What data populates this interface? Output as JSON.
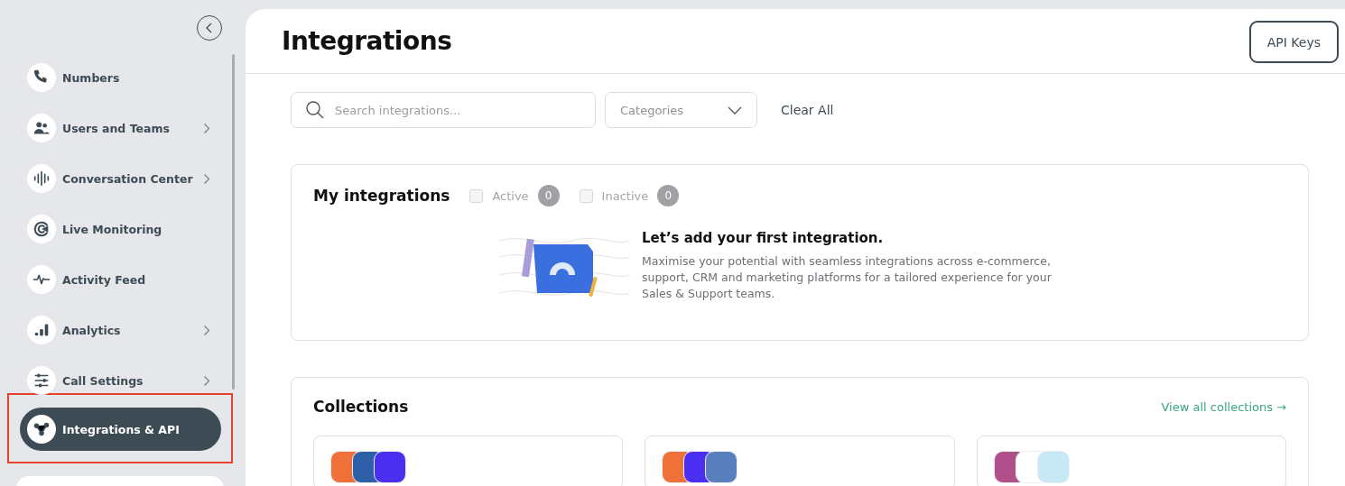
{
  "sidebar": {
    "items": [
      {
        "label": "Numbers",
        "has_submenu": false,
        "selected": false
      },
      {
        "label": "Users and Teams",
        "has_submenu": true,
        "selected": false
      },
      {
        "label": "Conversation Center",
        "has_submenu": true,
        "selected": false
      },
      {
        "label": "Live Monitoring",
        "has_submenu": false,
        "selected": false
      },
      {
        "label": "Activity Feed",
        "has_submenu": false,
        "selected": false
      },
      {
        "label": "Analytics",
        "has_submenu": true,
        "selected": false
      },
      {
        "label": "Call Settings",
        "has_submenu": true,
        "selected": false
      },
      {
        "label": "Integrations & API",
        "has_submenu": false,
        "selected": true,
        "highlighted": true
      }
    ]
  },
  "header": {
    "title": "Integrations",
    "button": "API Keys"
  },
  "filters": {
    "search_placeholder": "Search integrations...",
    "categories": "Categories",
    "clear": "Clear All"
  },
  "my_integrations": {
    "title": "My integrations",
    "filters": [
      {
        "label": "Active",
        "checked": false,
        "count": "0"
      },
      {
        "label": "Inactive",
        "checked": false,
        "count": "0"
      }
    ],
    "empty_title": "Let’s add your first integration.",
    "empty_text": "Maximise your potential with seamless integrations across e-commerce, support, CRM and marketing platforms for a tailored experience for your Sales & Support teams."
  },
  "collections": {
    "title": "Collections",
    "link": "View all collections →",
    "cards": [
      {
        "logos": [
          {
            "color": "#f0703a"
          },
          {
            "color": "#2f5fa8"
          },
          {
            "color": "#4a2ff0"
          }
        ]
      },
      {
        "logos": [
          {
            "color": "#f0703a"
          },
          {
            "color": "#4a2ff0"
          },
          {
            "color": "#5a7fbf"
          }
        ]
      },
      {
        "logos": [
          {
            "color": "#b0508a"
          },
          {
            "color": "#ffffff"
          },
          {
            "color": "#c6e9f5"
          }
        ]
      }
    ]
  }
}
